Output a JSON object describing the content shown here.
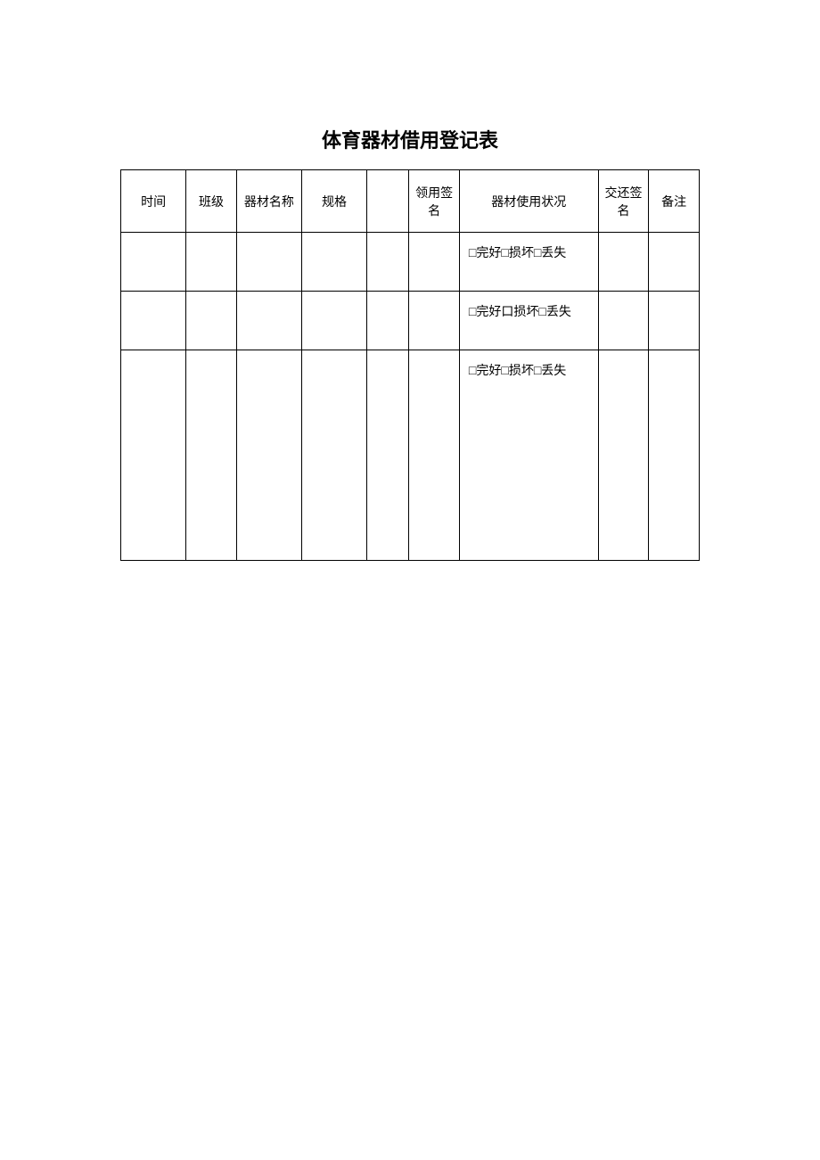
{
  "title": "体育器材借用登记表",
  "headers": {
    "time": "时间",
    "class": "班级",
    "equip_name": "器材名称",
    "spec": "规格",
    "blank": "",
    "receive_sign": "领用签名",
    "status": "器材使用状况",
    "return_sign": "交还签名",
    "note": "备注"
  },
  "rows": [
    {
      "time": "",
      "class": "",
      "equip_name": "",
      "spec": "",
      "blank": "",
      "receive_sign": "",
      "status": "□完好□损坏□丢失",
      "return_sign": "",
      "note": ""
    },
    {
      "time": "",
      "class": "",
      "equip_name": "",
      "spec": "",
      "blank": "",
      "receive_sign": "",
      "status": "□完好口损坏□丢失",
      "return_sign": "",
      "note": ""
    },
    {
      "time": "",
      "class": "",
      "equip_name": "",
      "spec": "",
      "blank": "",
      "receive_sign": "",
      "status": "□完好□损坏□丢失",
      "return_sign": "",
      "note": ""
    }
  ]
}
